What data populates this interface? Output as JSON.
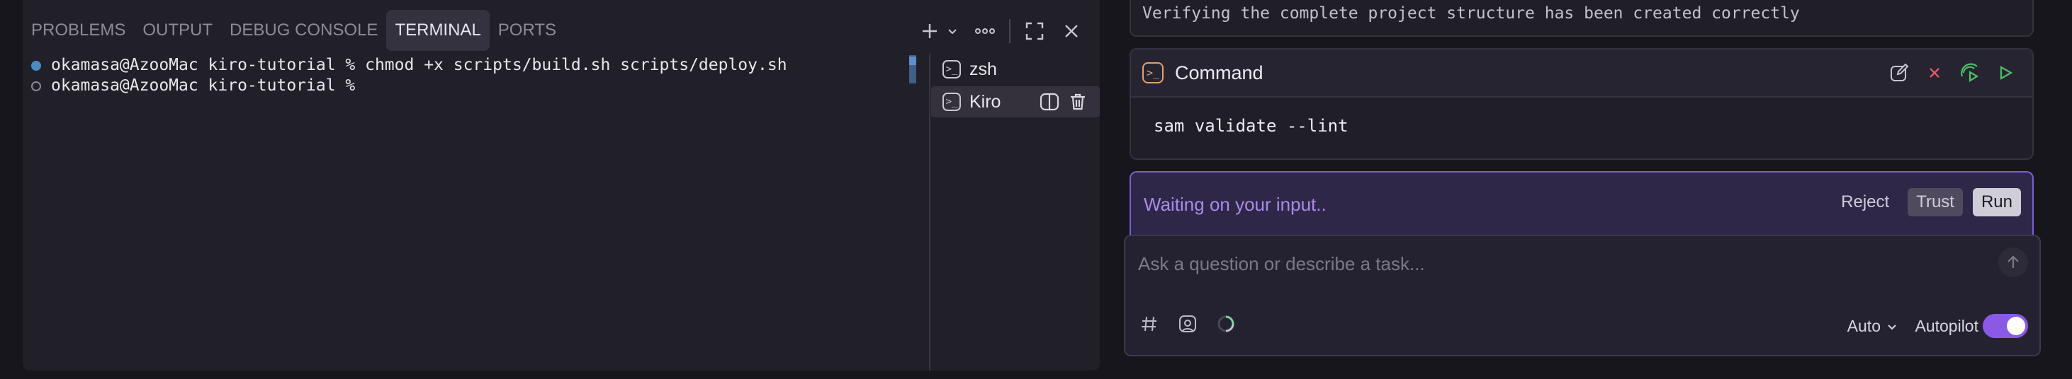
{
  "panel": {
    "tabs": [
      {
        "label": "PROBLEMS"
      },
      {
        "label": "OUTPUT"
      },
      {
        "label": "DEBUG CONSOLE"
      },
      {
        "label": "TERMINAL",
        "active": true
      },
      {
        "label": "PORTS"
      }
    ],
    "actions": [
      "plus-icon",
      "chevron-down-icon",
      "more-icon",
      "maximize-icon",
      "close-icon"
    ]
  },
  "terminal": {
    "lines": [
      {
        "text": "okamasa@AzooMac kiro-tutorial % chmod +x scripts/build.sh scripts/deploy.sh",
        "status": "done"
      },
      {
        "text": "okamasa@AzooMac kiro-tutorial % ",
        "status": "pending"
      }
    ],
    "list": [
      {
        "label": "zsh",
        "selected": false
      },
      {
        "label": "Kiro",
        "selected": true
      }
    ]
  },
  "chat": {
    "verify_text": "Verifying the complete project structure has been created correctly",
    "command_title": "Command",
    "command_text": "sam validate --lint",
    "waiting_text": "Waiting on your input..",
    "reject_label": "Reject",
    "trust_label": "Trust",
    "run_label": "Run",
    "prompt_placeholder": "Ask a question or describe a task...",
    "mode_label": "Auto",
    "autopilot_label": "Autopilot",
    "autopilot_on": true
  },
  "colors": {
    "accent": "#8a5ae6",
    "waiting_text": "#a98be8",
    "command_icon": "#e8a06a",
    "reject_x": "#e05a5a",
    "run_green": "#4fbf6a"
  }
}
